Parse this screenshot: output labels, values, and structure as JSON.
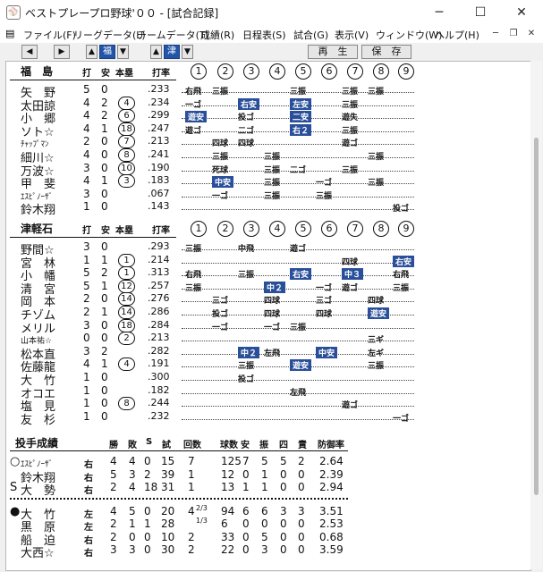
{
  "window": {
    "title": "ベストプレープロ野球'００ - [試合記録]",
    "icon": "app-icon",
    "buttons": {
      "minimize": "─",
      "maximize": "☐",
      "close": "✕"
    }
  },
  "menu": {
    "items": [
      "ファイル(F)",
      "リーグデータ(L)",
      "チームデータ(T)",
      "成績(R)",
      "日程表(S)",
      "試合(G)",
      "表示(V)",
      "ウィンドウ(W)",
      "ヘルプ(H)"
    ],
    "mdi": {
      "min": "─",
      "restore": "❐",
      "close": "✕"
    }
  },
  "toolbar": {
    "prev": "◀",
    "next": "▶",
    "team1_label": "福",
    "team2_label": "津",
    "up": "▲",
    "down": "▼",
    "replay_label": "再　生",
    "save_label": "保　存"
  },
  "batting_header": {
    "ab": "打",
    "h": "安",
    "hr": "本塁",
    "avg": "打率",
    "innings": [
      "1",
      "2",
      "3",
      "4",
      "5",
      "6",
      "7",
      "8",
      "9"
    ]
  },
  "teams": [
    {
      "name": "福　島",
      "players": [
        {
          "name": "矢　野",
          "ab": "5",
          "h": "0",
          "hr": "",
          "avg": ".233",
          "res": [
            {
              "t": "右飛"
            },
            {
              "t": "三振"
            },
            {
              "t": ""
            },
            {
              "t": ""
            },
            {
              "t": "三振"
            },
            {
              "t": ""
            },
            {
              "t": "三振"
            },
            {
              "t": "三振"
            },
            {
              "t": ""
            }
          ]
        },
        {
          "name": "太田諒",
          "ab": "4",
          "h": "2",
          "hr": "4",
          "avg": ".234",
          "res": [
            {
              "t": "一ゴ"
            },
            {
              "t": ""
            },
            {
              "t": "右安",
              "hl": true
            },
            {
              "t": ""
            },
            {
              "t": "左安",
              "hl": true
            },
            {
              "t": ""
            },
            {
              "t": "三振"
            },
            {
              "t": ""
            },
            {
              "t": ""
            }
          ]
        },
        {
          "name": "小　郷",
          "ab": "4",
          "h": "2",
          "hr": "6",
          "avg": ".299",
          "res": [
            {
              "t": "遊安",
              "hl": true
            },
            {
              "t": ""
            },
            {
              "t": "投ゴ"
            },
            {
              "t": ""
            },
            {
              "t": "二安",
              "hl": true
            },
            {
              "t": ""
            },
            {
              "t": "遊失"
            },
            {
              "t": ""
            },
            {
              "t": ""
            }
          ]
        },
        {
          "name": "ソト☆",
          "ab": "4",
          "h": "1",
          "hr": "18",
          "avg": ".247",
          "res": [
            {
              "t": "遊ゴ"
            },
            {
              "t": ""
            },
            {
              "t": "二ゴ"
            },
            {
              "t": ""
            },
            {
              "t": "右２",
              "hl": true
            },
            {
              "t": ""
            },
            {
              "t": "三振"
            },
            {
              "t": ""
            },
            {
              "t": ""
            }
          ]
        },
        {
          "name": "ﾁｬｯﾌﾟﾏﾝ",
          "small": true,
          "ab": "2",
          "h": "0",
          "hr": "7",
          "avg": ".213",
          "res": [
            {
              "t": ""
            },
            {
              "t": "四球"
            },
            {
              "t": "四球"
            },
            {
              "t": ""
            },
            {
              "t": ""
            },
            {
              "t": ""
            },
            {
              "t": "遊ゴ"
            },
            {
              "t": ""
            },
            {
              "t": ""
            }
          ]
        },
        {
          "name": "細川☆",
          "ab": "4",
          "h": "0",
          "hr": "8",
          "avg": ".241",
          "res": [
            {
              "t": ""
            },
            {
              "t": "三振"
            },
            {
              "t": ""
            },
            {
              "t": "三振"
            },
            {
              "t": ""
            },
            {
              "t": ""
            },
            {
              "t": ""
            },
            {
              "t": "三振"
            },
            {
              "t": ""
            }
          ]
        },
        {
          "name": "万波☆",
          "ab": "3",
          "h": "0",
          "hr": "10",
          "avg": ".190",
          "res": [
            {
              "t": ""
            },
            {
              "t": "死球"
            },
            {
              "t": ""
            },
            {
              "t": "三振"
            },
            {
              "t": "二ゴ"
            },
            {
              "t": ""
            },
            {
              "t": "三振"
            },
            {
              "t": ""
            },
            {
              "t": ""
            }
          ]
        },
        {
          "name": "甲　斐",
          "ab": "4",
          "h": "1",
          "hr": "3",
          "avg": ".183",
          "res": [
            {
              "t": ""
            },
            {
              "t": "中安",
              "hl": true
            },
            {
              "t": ""
            },
            {
              "t": "三振"
            },
            {
              "t": ""
            },
            {
              "t": "一ゴ"
            },
            {
              "t": ""
            },
            {
              "t": "三振"
            },
            {
              "t": ""
            }
          ]
        },
        {
          "name": "ｴｽﾋﾟﾉｰｻﾞ",
          "small": true,
          "ab": "3",
          "h": "0",
          "hr": "",
          "avg": ".067",
          "res": [
            {
              "t": ""
            },
            {
              "t": "一ゴ"
            },
            {
              "t": ""
            },
            {
              "t": "三振"
            },
            {
              "t": ""
            },
            {
              "t": "三振"
            },
            {
              "t": ""
            },
            {
              "t": ""
            },
            {
              "t": ""
            }
          ]
        },
        {
          "name": "鈴木翔",
          "ab": "1",
          "h": "0",
          "hr": "",
          "avg": ".143",
          "res": [
            {
              "t": ""
            },
            {
              "t": ""
            },
            {
              "t": ""
            },
            {
              "t": ""
            },
            {
              "t": ""
            },
            {
              "t": ""
            },
            {
              "t": ""
            },
            {
              "t": ""
            },
            {
              "t": "投ゴ"
            }
          ]
        }
      ]
    },
    {
      "name": "津軽石",
      "players": [
        {
          "name": "野間☆",
          "ab": "3",
          "h": "0",
          "hr": "",
          "avg": ".293",
          "res": [
            {
              "t": "三振"
            },
            {
              "t": ""
            },
            {
              "t": "中飛"
            },
            {
              "t": ""
            },
            {
              "t": "遊ゴ"
            },
            {
              "t": ""
            },
            {
              "t": ""
            },
            {
              "t": ""
            },
            {
              "t": ""
            }
          ]
        },
        {
          "name": "宮　林",
          "ab": "1",
          "h": "1",
          "hr": "1",
          "avg": ".214",
          "res": [
            {
              "t": ""
            },
            {
              "t": ""
            },
            {
              "t": ""
            },
            {
              "t": ""
            },
            {
              "t": ""
            },
            {
              "t": ""
            },
            {
              "t": "四球"
            },
            {
              "t": ""
            },
            {
              "t": "右安",
              "hl": true
            }
          ]
        },
        {
          "name": "小　幡",
          "ab": "5",
          "h": "2",
          "hr": "1",
          "avg": ".313",
          "res": [
            {
              "t": "右飛"
            },
            {
              "t": ""
            },
            {
              "t": "三振"
            },
            {
              "t": ""
            },
            {
              "t": "右安",
              "hl": true
            },
            {
              "t": ""
            },
            {
              "t": "中３",
              "hl": true
            },
            {
              "t": ""
            },
            {
              "t": "右飛"
            }
          ]
        },
        {
          "name": "清　宮",
          "ab": "5",
          "h": "1",
          "hr": "12",
          "avg": ".257",
          "res": [
            {
              "t": "三振"
            },
            {
              "t": ""
            },
            {
              "t": ""
            },
            {
              "t": "中２",
              "hl": true
            },
            {
              "t": ""
            },
            {
              "t": "一ゴ"
            },
            {
              "t": "遊ゴ"
            },
            {
              "t": ""
            },
            {
              "t": "三振"
            }
          ]
        },
        {
          "name": "岡　本",
          "ab": "2",
          "h": "0",
          "hr": "14",
          "avg": ".276",
          "res": [
            {
              "t": ""
            },
            {
              "t": "三ゴ"
            },
            {
              "t": ""
            },
            {
              "t": "四球"
            },
            {
              "t": ""
            },
            {
              "t": "三ゴ"
            },
            {
              "t": ""
            },
            {
              "t": "四球"
            },
            {
              "t": ""
            }
          ]
        },
        {
          "name": "チゾム",
          "ab": "2",
          "h": "1",
          "hr": "14",
          "avg": ".286",
          "res": [
            {
              "t": ""
            },
            {
              "t": "投ゴ"
            },
            {
              "t": ""
            },
            {
              "t": "四球"
            },
            {
              "t": ""
            },
            {
              "t": "四球"
            },
            {
              "t": ""
            },
            {
              "t": "遊安",
              "hl": true
            },
            {
              "t": ""
            }
          ]
        },
        {
          "name": "メリル",
          "ab": "3",
          "h": "0",
          "hr": "18",
          "avg": ".284",
          "res": [
            {
              "t": ""
            },
            {
              "t": "一ゴ"
            },
            {
              "t": ""
            },
            {
              "t": "一ゴ"
            },
            {
              "t": "三振"
            },
            {
              "t": ""
            },
            {
              "t": ""
            },
            {
              "t": ""
            },
            {
              "t": ""
            }
          ]
        },
        {
          "name": "山本祐☆",
          "small": true,
          "ab": "0",
          "h": "0",
          "hr": "2",
          "avg": ".213",
          "res": [
            {
              "t": ""
            },
            {
              "t": ""
            },
            {
              "t": ""
            },
            {
              "t": ""
            },
            {
              "t": ""
            },
            {
              "t": ""
            },
            {
              "t": ""
            },
            {
              "t": "三ギ"
            },
            {
              "t": ""
            }
          ]
        },
        {
          "name": "松本直",
          "ab": "3",
          "h": "2",
          "hr": "",
          "avg": ".282",
          "res": [
            {
              "t": ""
            },
            {
              "t": ""
            },
            {
              "t": "中２",
              "hl": true
            },
            {
              "t": "左飛"
            },
            {
              "t": ""
            },
            {
              "t": "中安",
              "hl": true
            },
            {
              "t": ""
            },
            {
              "t": "左ギ"
            },
            {
              "t": ""
            }
          ]
        },
        {
          "name": "佐藤龍",
          "ab": "4",
          "h": "1",
          "hr": "4",
          "avg": ".191",
          "res": [
            {
              "t": ""
            },
            {
              "t": ""
            },
            {
              "t": "三振"
            },
            {
              "t": ""
            },
            {
              "t": "遊安",
              "hl": true
            },
            {
              "t": ""
            },
            {
              "t": ""
            },
            {
              "t": "三振"
            },
            {
              "t": ""
            }
          ]
        },
        {
          "name": "大　竹",
          "ab": "1",
          "h": "0",
          "hr": "",
          "avg": ".300",
          "res": [
            {
              "t": ""
            },
            {
              "t": ""
            },
            {
              "t": "投ゴ"
            },
            {
              "t": ""
            },
            {
              "t": ""
            },
            {
              "t": ""
            },
            {
              "t": ""
            },
            {
              "t": ""
            },
            {
              "t": ""
            }
          ]
        },
        {
          "name": "オコエ",
          "ab": "1",
          "h": "0",
          "hr": "",
          "avg": ".182",
          "res": [
            {
              "t": ""
            },
            {
              "t": ""
            },
            {
              "t": ""
            },
            {
              "t": ""
            },
            {
              "t": "左飛"
            },
            {
              "t": ""
            },
            {
              "t": ""
            },
            {
              "t": ""
            },
            {
              "t": ""
            }
          ]
        },
        {
          "name": "塩　見",
          "ab": "1",
          "h": "0",
          "hr": "8",
          "avg": ".244",
          "res": [
            {
              "t": ""
            },
            {
              "t": ""
            },
            {
              "t": ""
            },
            {
              "t": ""
            },
            {
              "t": ""
            },
            {
              "t": ""
            },
            {
              "t": "遊ゴ"
            },
            {
              "t": ""
            },
            {
              "t": ""
            }
          ]
        },
        {
          "name": "友　杉",
          "ab": "1",
          "h": "0",
          "hr": "",
          "avg": ".232",
          "res": [
            {
              "t": ""
            },
            {
              "t": ""
            },
            {
              "t": ""
            },
            {
              "t": ""
            },
            {
              "t": ""
            },
            {
              "t": ""
            },
            {
              "t": ""
            },
            {
              "t": ""
            },
            {
              "t": "一ゴ"
            }
          ]
        }
      ]
    }
  ],
  "pitching": {
    "title": "投手成績",
    "headers": {
      "w": "勝",
      "l": "敗",
      "s": "S",
      "g": "試",
      "inn": "回数",
      "bf": "球数",
      "h": "安",
      "so": "振",
      "bb": "四",
      "er": "責",
      "era": "防御率"
    },
    "groups": [
      [
        {
          "mark": "○",
          "name": "ｴｽﾋﾟﾉｰｻﾞ",
          "small": true,
          "hand": "右",
          "w": "4",
          "l": "4",
          "s": "0",
          "g": "15",
          "inn": "7",
          "frac": "",
          "bf": "125",
          "h": "7",
          "so": "5",
          "bb": "5",
          "er": "2",
          "era": "2.64"
        },
        {
          "mark": "",
          "name": "鈴木翔",
          "hand": "右",
          "w": "5",
          "l": "3",
          "s": "2",
          "g": "39",
          "inn": "1",
          "frac": "",
          "bf": "12",
          "h": "0",
          "so": "1",
          "bb": "0",
          "er": "0",
          "era": "2.39"
        },
        {
          "mark": "S",
          "name": "大　勢",
          "hand": "右",
          "w": "2",
          "l": "4",
          "s": "18",
          "g": "31",
          "inn": "1",
          "frac": "",
          "bf": "13",
          "h": "1",
          "so": "1",
          "bb": "0",
          "er": "0",
          "era": "2.94"
        }
      ],
      [
        {
          "mark": "●",
          "name": "大　竹",
          "hand": "左",
          "w": "4",
          "l": "5",
          "s": "0",
          "g": "20",
          "inn": "4",
          "frac": "2/3",
          "bf": "94",
          "h": "6",
          "so": "6",
          "bb": "3",
          "er": "3",
          "era": "3.51"
        },
        {
          "mark": "",
          "name": "黒　原",
          "hand": "左",
          "w": "2",
          "l": "1",
          "s": "1",
          "g": "28",
          "inn": "",
          "frac": "1/3",
          "bf": "6",
          "h": "0",
          "so": "0",
          "bb": "0",
          "er": "0",
          "era": "2.53"
        },
        {
          "mark": "",
          "name": "船　迫",
          "hand": "右",
          "w": "2",
          "l": "0",
          "s": "0",
          "g": "10",
          "inn": "2",
          "frac": "",
          "bf": "33",
          "h": "0",
          "so": "5",
          "bb": "0",
          "er": "0",
          "era": "0.68"
        },
        {
          "mark": "",
          "name": "大西☆",
          "hand": "右",
          "w": "3",
          "l": "3",
          "s": "0",
          "g": "30",
          "inn": "2",
          "frac": "",
          "bf": "22",
          "h": "0",
          "so": "3",
          "bb": "0",
          "er": "0",
          "era": "3.59"
        }
      ]
    ]
  }
}
